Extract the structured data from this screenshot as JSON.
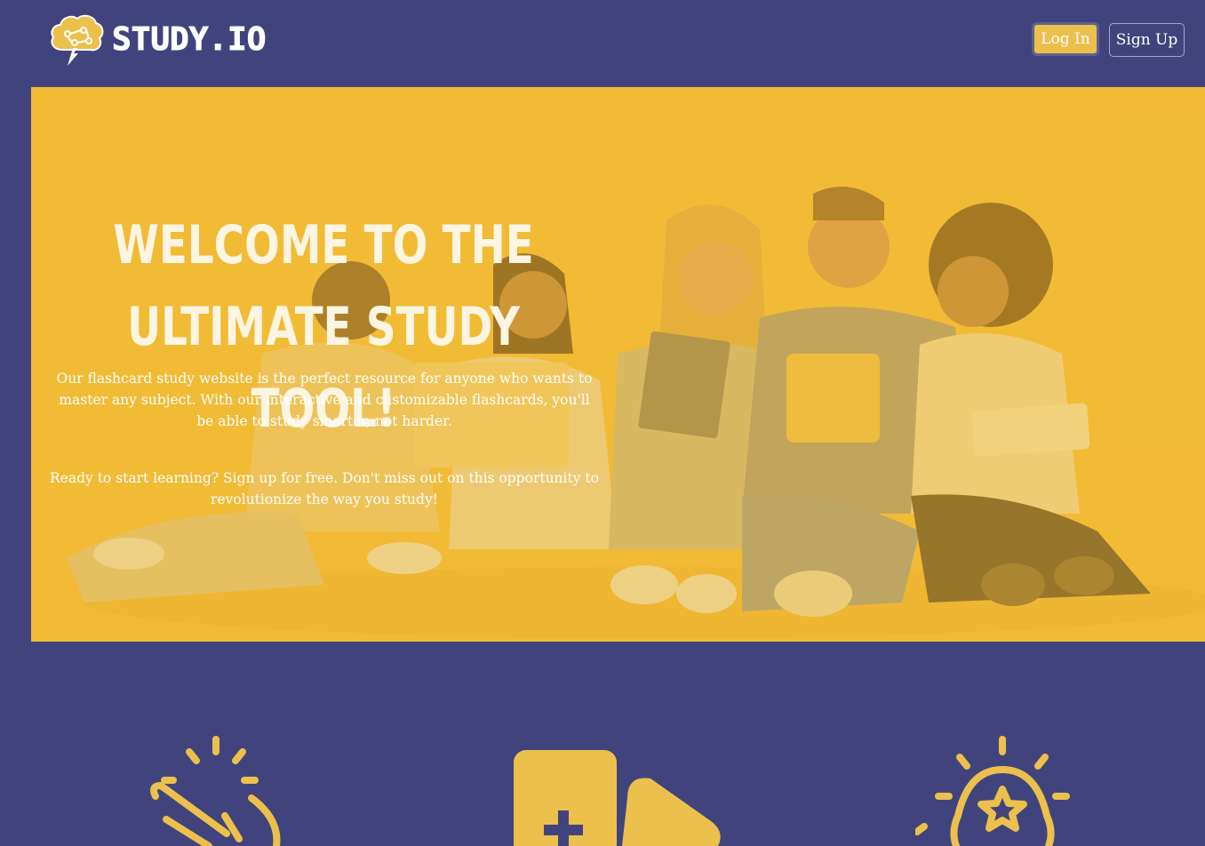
{
  "navbar": {
    "logo_text": "STUDY.IO",
    "login_label": "Log In",
    "signup_label": "Sign Up"
  },
  "hero": {
    "title": "Welcome to the ultimate study tool!",
    "body": "Our flashcard study website is the perfect resource for anyone who wants to master any subject. With our interactive and customizable flashcards, you'll be able to study smarter, not harder.",
    "cta": "Ready to start learning? Sign up for free. Don't miss out on this opportunity to revolutionize the way you study!"
  },
  "features": {
    "icons": [
      "clapping-hand-icon",
      "add-flashcard-icon",
      "lightbulb-star-icon"
    ]
  },
  "colors": {
    "background": "#41447c",
    "accent": "#ecc04c",
    "hero_overlay": "#f0ba32"
  }
}
